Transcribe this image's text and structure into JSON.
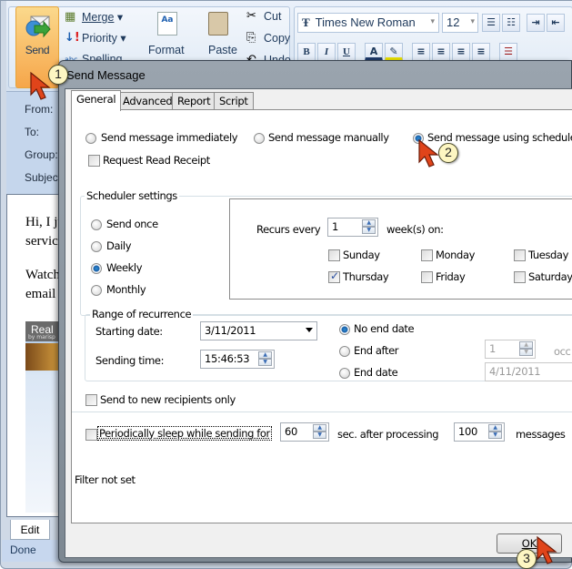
{
  "ribbon": {
    "send_label": "Send",
    "merge_label": "Merge",
    "priority_label": "Priority",
    "spelling_label": "Spelling",
    "format_label": "Format",
    "paste_label": "Paste",
    "cut_label": "Cut",
    "copy_label": "Copy",
    "undo_label": "Undo",
    "font_name": "Times New Roman",
    "font_size": "12",
    "bold": "B",
    "italic": "I",
    "underline": "U"
  },
  "message_headers": {
    "from_label": "From:",
    "to_label": "To:",
    "group_label": "Group:",
    "subject_label": "Subject"
  },
  "message_body": {
    "line1": "Hi, I ju",
    "line2": "servic",
    "line3": "Watch",
    "line4": "email r",
    "thumb_title": "Real",
    "thumb_sub": "by marisp"
  },
  "bottom": {
    "edit_tab": "Edit",
    "status": "Done"
  },
  "dialog": {
    "title": "Send Message",
    "tabs": [
      {
        "label": "General",
        "active": true
      },
      {
        "label": "Advanced",
        "active": false
      },
      {
        "label": "Report",
        "active": false
      },
      {
        "label": "Script",
        "active": false
      }
    ],
    "send_mode": {
      "options": [
        "Send message immediately",
        "Send message manually",
        "Send message using scheduler"
      ],
      "selected": "Send message using scheduler"
    },
    "request_read_receipt": {
      "label": "Request Read Receipt",
      "checked": false
    },
    "scheduler": {
      "group_label": "Scheduler settings",
      "frequency_options": [
        "Send once",
        "Daily",
        "Weekly",
        "Monthly"
      ],
      "selected_frequency": "Weekly",
      "recurs_every_label": "Recurs every",
      "recurs_every_value": "1",
      "weeks_on_label": "week(s) on:",
      "days": [
        {
          "label": "Sunday",
          "checked": false
        },
        {
          "label": "Monday",
          "checked": false
        },
        {
          "label": "Tuesday",
          "checked": false
        },
        {
          "label": "Thursday",
          "checked": true
        },
        {
          "label": "Friday",
          "checked": false
        },
        {
          "label": "Saturday",
          "checked": false
        }
      ]
    },
    "range": {
      "group_label": "Range of recurrence",
      "starting_date_label": "Starting date:",
      "starting_date_value": "3/11/2011",
      "sending_time_label": "Sending time:",
      "sending_time_value": "15:46:53",
      "end_options": [
        "No end date",
        "End after",
        "End date"
      ],
      "selected_end": "No end date",
      "end_after_value": "1",
      "occurrences_label": "occ",
      "end_date_value": "4/11/2011"
    },
    "new_recipients_only": {
      "label": "Send to new recipients only",
      "checked": false
    },
    "sleep": {
      "label": "Periodically sleep while sending for",
      "checked": false,
      "seconds_value": "60",
      "after_label": "sec. after processing",
      "messages_value": "100",
      "messages_label": "messages"
    },
    "filter_status": "Filter not set",
    "ok_label": "OK"
  },
  "callouts": [
    "1",
    "2",
    "3"
  ]
}
